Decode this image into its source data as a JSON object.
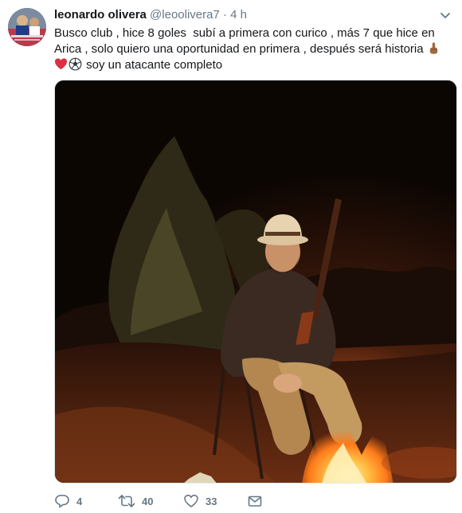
{
  "tweet": {
    "display_name": "leonardo olivera",
    "handle": "@leoolivera7",
    "separator": "·",
    "time": "4 h",
    "text_main": "Busco club , hice 8 goles  subí a primera con curico , más 7 que hice en Arica , solo quiero una oportunidad en primera , después será historia ",
    "text_tail": " soy un atacante completo",
    "emojis": [
      "pointing-up-emoji",
      "red-heart-emoji",
      "soccer-ball-emoji"
    ]
  },
  "actions": {
    "reply_count": "4",
    "retweet_count": "40",
    "like_count": "33"
  },
  "colors": {
    "text": "#14171a",
    "secondary": "#657786",
    "border": "#e1e8ed",
    "heart": "#e0245e"
  }
}
